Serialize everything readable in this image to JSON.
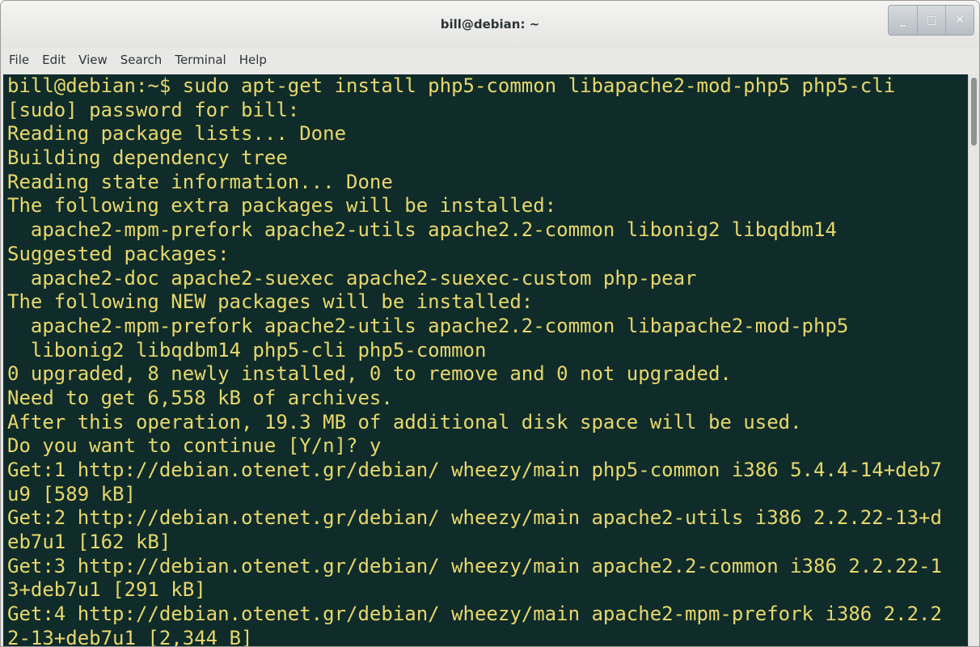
{
  "window": {
    "title": "bill@debian: ~",
    "buttons": [
      "_",
      "□",
      "✕"
    ]
  },
  "menubar": {
    "items": [
      "File",
      "Edit",
      "View",
      "Search",
      "Terminal",
      "Help"
    ]
  },
  "terminal": {
    "text_color": "#e8d76c",
    "background_color": "#0f2c2a",
    "lines": [
      "bill@debian:~$ sudo apt-get install php5-common libapache2-mod-php5 php5-cli",
      "[sudo] password for bill:",
      "Reading package lists... Done",
      "Building dependency tree",
      "Reading state information... Done",
      "The following extra packages will be installed:",
      "  apache2-mpm-prefork apache2-utils apache2.2-common libonig2 libqdbm14",
      "Suggested packages:",
      "  apache2-doc apache2-suexec apache2-suexec-custom php-pear",
      "The following NEW packages will be installed:",
      "  apache2-mpm-prefork apache2-utils apache2.2-common libapache2-mod-php5",
      "  libonig2 libqdbm14 php5-cli php5-common",
      "0 upgraded, 8 newly installed, 0 to remove and 0 not upgraded.",
      "Need to get 6,558 kB of archives.",
      "After this operation, 19.3 MB of additional disk space will be used.",
      "Do you want to continue [Y/n]? y",
      "Get:1 http://debian.otenet.gr/debian/ wheezy/main php5-common i386 5.4.4-14+deb7",
      "u9 [589 kB]",
      "Get:2 http://debian.otenet.gr/debian/ wheezy/main apache2-utils i386 2.2.22-13+d",
      "eb7u1 [162 kB]",
      "Get:3 http://debian.otenet.gr/debian/ wheezy/main apache2.2-common i386 2.2.22-1",
      "3+deb7u1 [291 kB]",
      "Get:4 http://debian.otenet.gr/debian/ wheezy/main apache2-mpm-prefork i386 2.2.2",
      "2-13+deb7u1 [2,344 B]"
    ]
  }
}
